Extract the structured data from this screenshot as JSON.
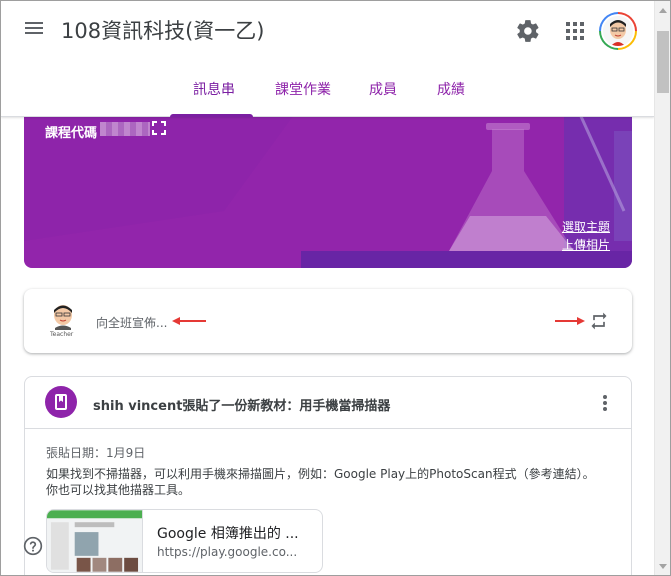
{
  "header": {
    "course_title": "108資訊科技(資一乙)",
    "icons": {
      "menu": "menu-icon",
      "settings": "gear-icon",
      "apps": "apps-grid-icon",
      "account": "account-avatar"
    }
  },
  "tabs": [
    {
      "label": "訊息串",
      "active": true
    },
    {
      "label": "課堂作業",
      "active": false
    },
    {
      "label": "成員",
      "active": false
    },
    {
      "label": "成績",
      "active": false
    }
  ],
  "banner": {
    "code_label": "課程代碼",
    "select_theme": "選取主題",
    "upload_photo": "上傳相片",
    "background_color": "#8e24aa"
  },
  "composer": {
    "placeholder": "向全班宣佈...",
    "avatar_caption": "Teacher"
  },
  "post": {
    "title": "shih vincent張貼了一份新教材：用手機當掃描器",
    "date": "張貼日期：1月9日",
    "body_line1": "如果找到不掃描器，可以利用手機來掃描圖片，例如：Google Play上的PhotoScan程式（參考連結）。",
    "body_line2": "你也可以找其他描器工具。",
    "link_title": "Google 相簿推出的 ...",
    "link_url": "https://play.google.co..."
  },
  "colors": {
    "accent": "#7b1fa2",
    "tab_text": "#8e24aa",
    "arrow": "#e53935"
  }
}
